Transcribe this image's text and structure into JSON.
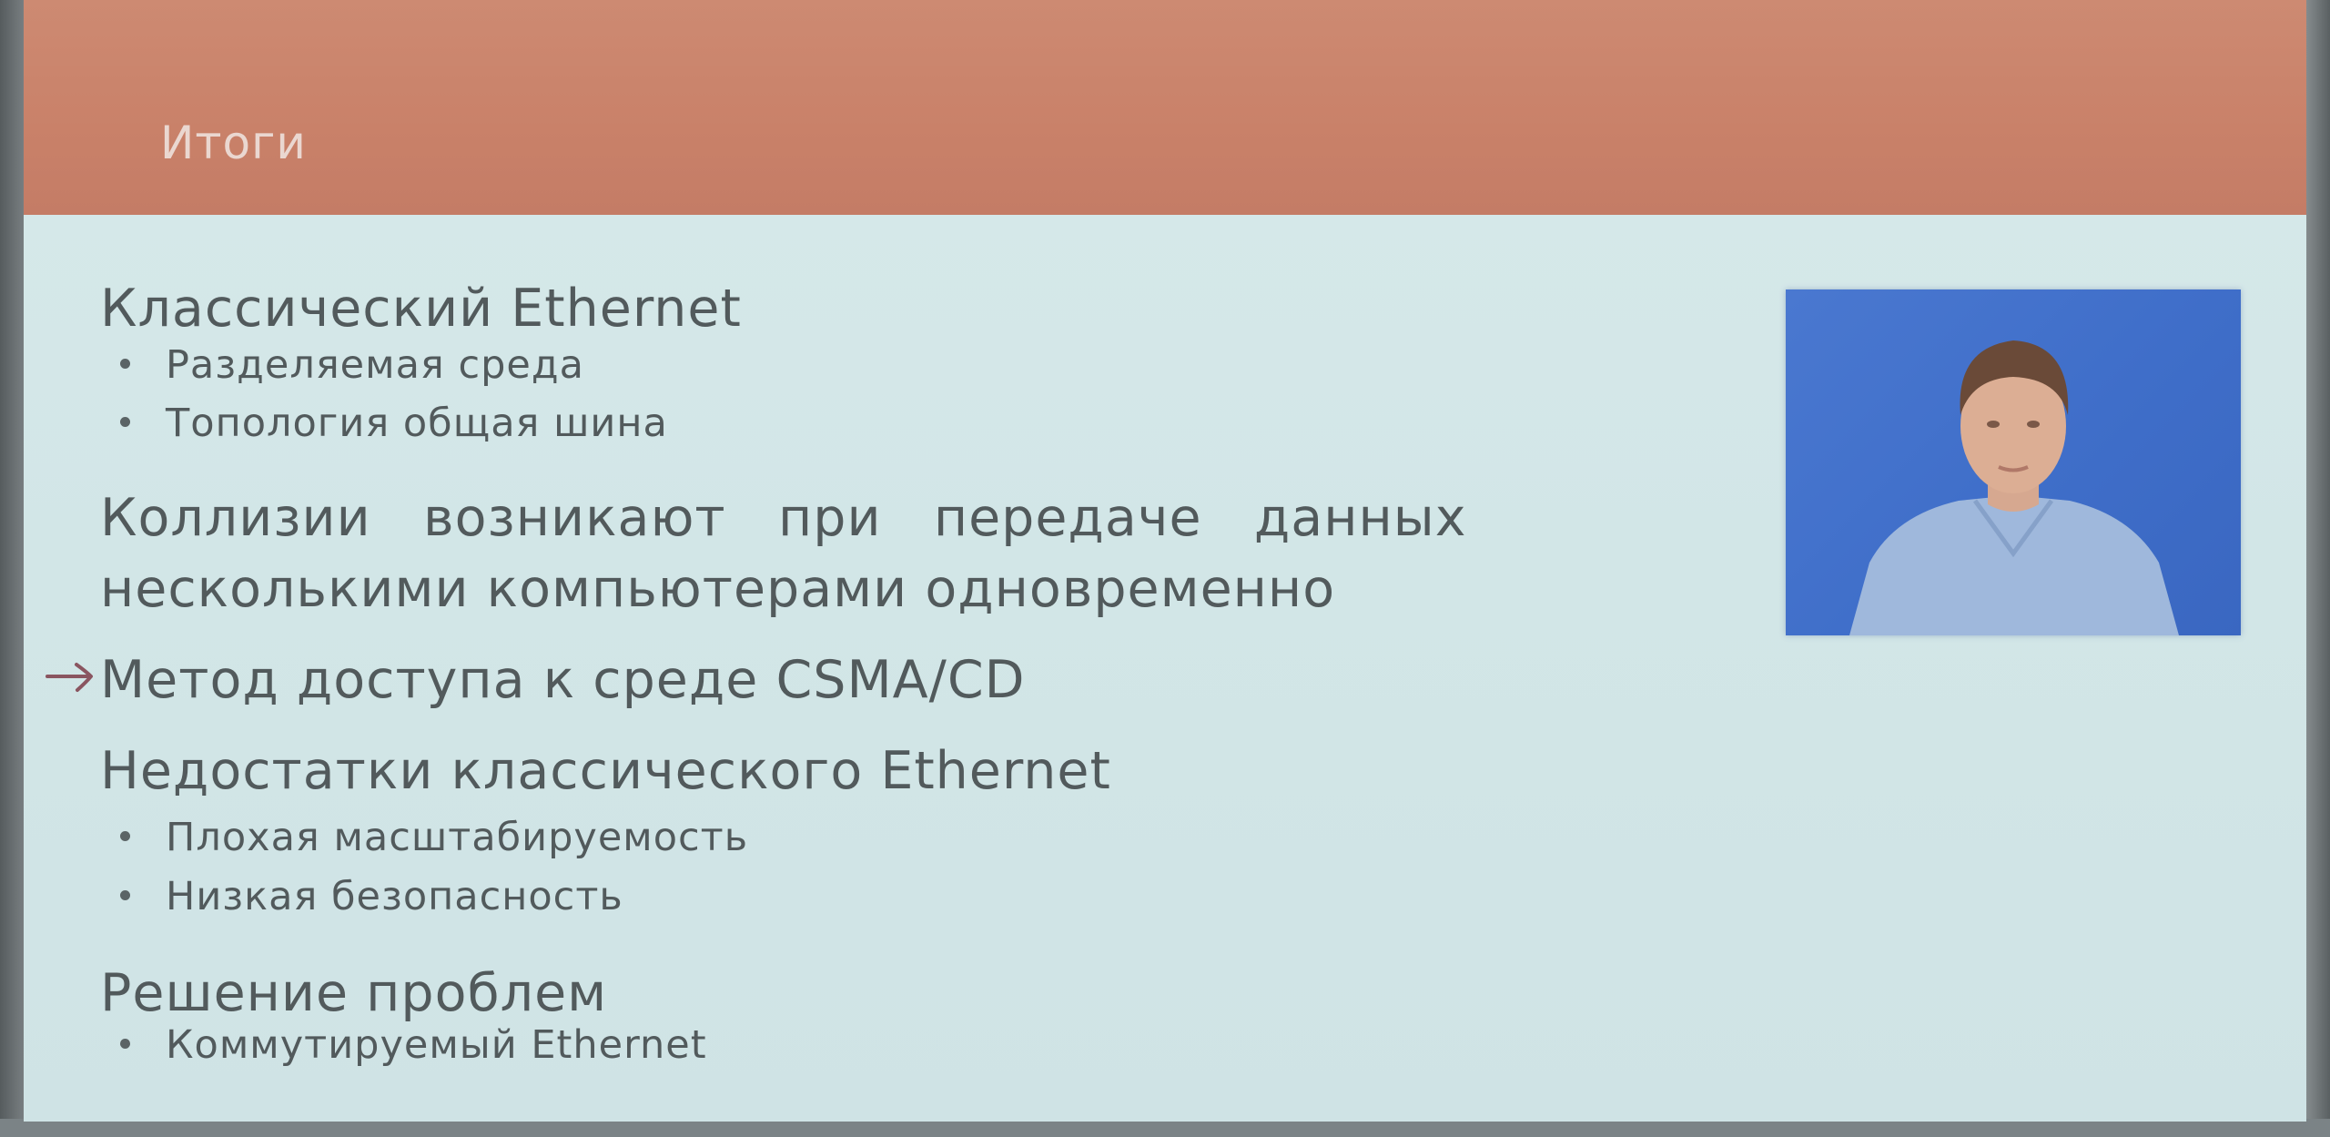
{
  "slide": {
    "title": "Итоги",
    "colors": {
      "header": "#c98169",
      "background": "#d3e7e8",
      "text": "#525a5c",
      "video_bg": "#4573cc"
    },
    "items": [
      {
        "heading": "Классический Ethernet",
        "bullets": [
          "Разделяемая среда",
          "Топология общая шина"
        ]
      },
      {
        "heading_line1": "Коллизии   возникают   при   передаче   данных",
        "heading_line2": "несколькими компьютерами одновременно"
      },
      {
        "heading": "Метод доступа к среде CSMA/CD",
        "marker": "arrow-icon"
      },
      {
        "heading": "Недостатки классического Ethernet",
        "bullets": [
          "Плохая масштабируемость",
          "Низкая безопасность"
        ]
      },
      {
        "heading": "Решение проблем",
        "bullets": [
          "Коммутируемый Ethernet"
        ]
      }
    ]
  }
}
